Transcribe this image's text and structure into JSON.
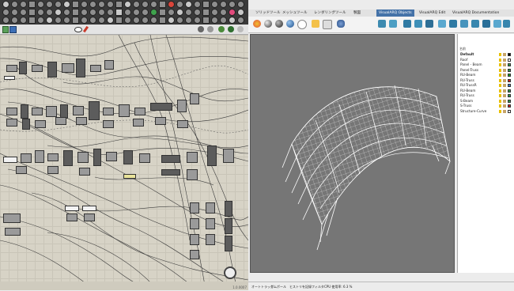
{
  "grasshopper": {
    "zoom_value": "67%",
    "zoom_label": "1.0.0007"
  },
  "rhino": {
    "tabs": [
      "ソリッドツール",
      "メッシュツール",
      "レンダリングツール",
      "製図",
      "VisualARQ Objects",
      "VisualARQ Edit",
      "VisualARQ Documentation"
    ],
    "active_tab_index": 4,
    "layers": {
      "header": "名前",
      "rows": [
        {
          "name": "Default",
          "bold": true,
          "color": "#000000"
        },
        {
          "name": "Roof",
          "color": "#ffffff"
        },
        {
          "name": "Panel - Beam",
          "color": "#2f9a4a"
        },
        {
          "name": "Panel-Truss",
          "color": "#2f9a4a"
        },
        {
          "name": "RU-Beam",
          "color": "#19a11f"
        },
        {
          "name": "RU-Truss",
          "color": "#d21d1d"
        },
        {
          "name": "RU-TrussR",
          "color": "#3a78d0"
        },
        {
          "name": "RU-Beam",
          "color": "#2f9a4a"
        },
        {
          "name": "RU-Truss",
          "color": "#2f9a4a"
        },
        {
          "name": "S-Beam",
          "color": "#2f9a4a"
        },
        {
          "name": "S-Truss",
          "color": "#d21d1d"
        },
        {
          "name": "Structure-Curve",
          "color": "#ffffff"
        }
      ]
    },
    "status": [
      "オートトラック",
      "ガムボール",
      "ヒストリを記録",
      "フィルタ",
      "CPU 使用率: 6.3 %"
    ]
  }
}
